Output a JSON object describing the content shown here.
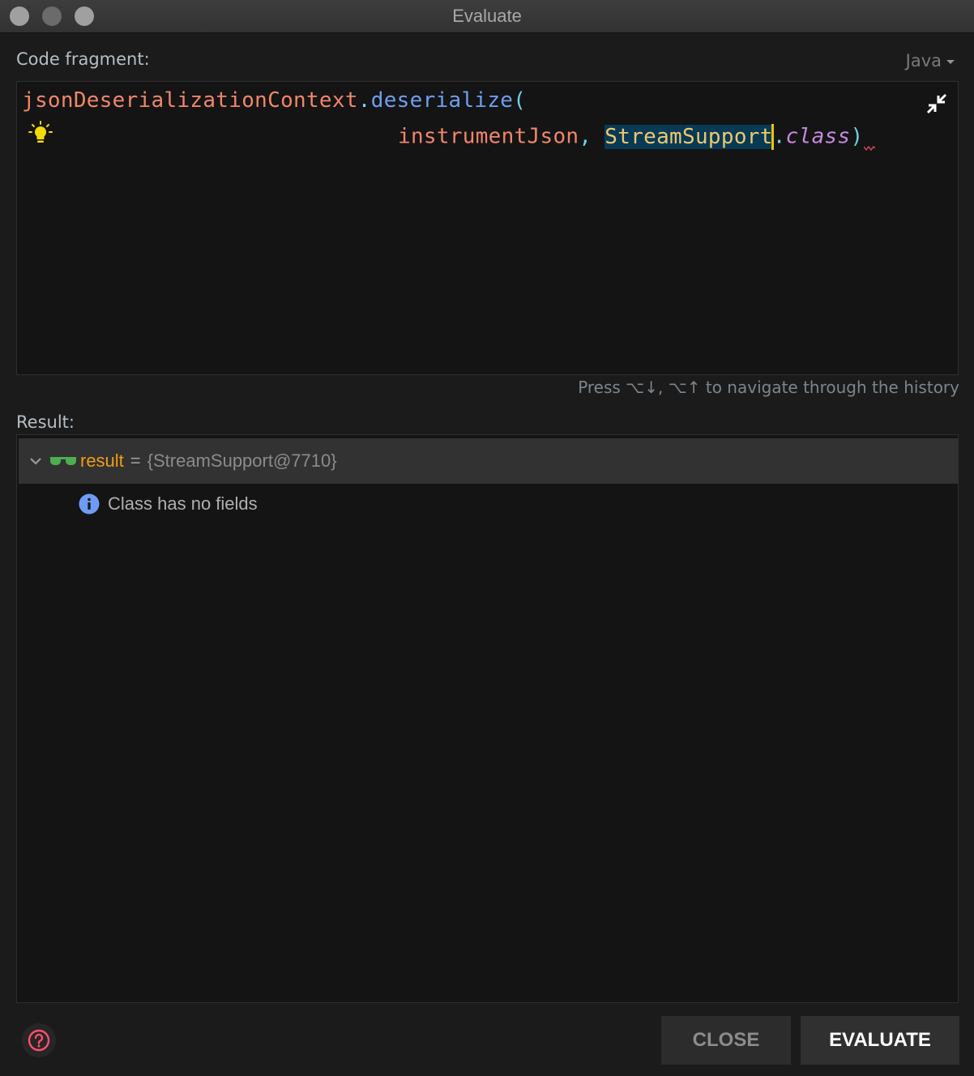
{
  "window": {
    "title": "Evaluate"
  },
  "code_fragment": {
    "label": "Code fragment:",
    "language": "Java",
    "line1": {
      "receiver": "jsonDeserializationContext",
      "dot": ".",
      "method": "deserialize",
      "open_paren": "("
    },
    "line2": {
      "indent": "                  ",
      "arg1": "instrumentJson",
      "comma": ", ",
      "class_name": "StreamSupport",
      "dot": ".",
      "keyword": "class",
      "close_paren": ")"
    },
    "history_hint": "Press ⌥↓, ⌥↑ to navigate through the history"
  },
  "result": {
    "label": "Result:",
    "name": "result",
    "equals": "=",
    "value": "{StreamSupport@7710}",
    "child_message": "Class has no fields"
  },
  "buttons": {
    "close": "CLOSE",
    "evaluate": "EVALUATE"
  },
  "colors": {
    "variable": "#f0866a",
    "method": "#6f9ff0",
    "class": "#f2c76e",
    "keyword": "#c48ae0",
    "result_name": "#f39c12",
    "help_icon": "#ff4f6d"
  }
}
